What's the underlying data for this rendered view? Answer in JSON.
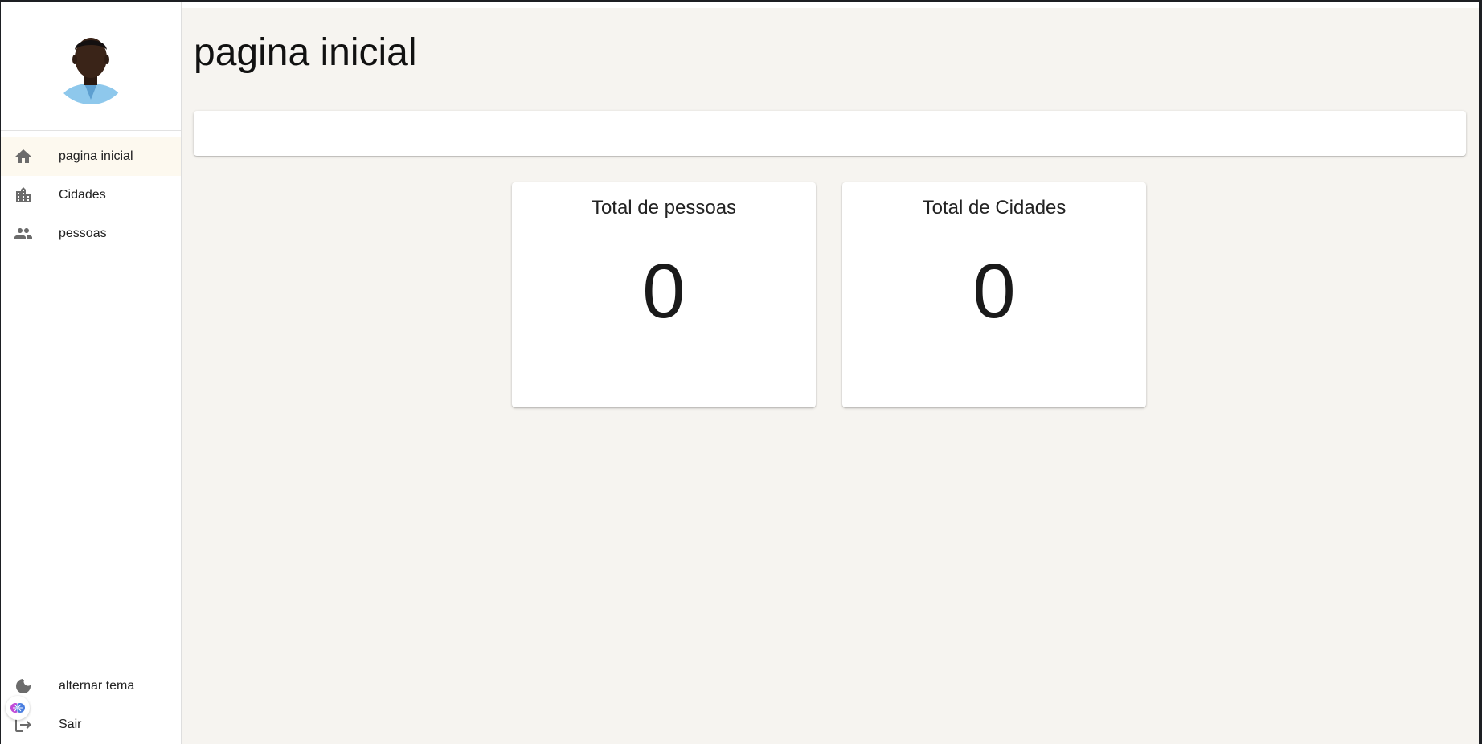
{
  "sidebar": {
    "items": [
      {
        "label": "pagina inicial",
        "icon": "home-icon",
        "active": true
      },
      {
        "label": "Cidades",
        "icon": "city-icon",
        "active": false
      },
      {
        "label": "pessoas",
        "icon": "people-icon",
        "active": false
      }
    ],
    "bottom_items": [
      {
        "label": "alternar tema",
        "icon": "moon-icon"
      },
      {
        "label": "Sair",
        "icon": "logout-icon"
      }
    ]
  },
  "main": {
    "title": "pagina inicial",
    "cards": [
      {
        "title": "Total de pessoas",
        "value": "0"
      },
      {
        "title": "Total de Cidades",
        "value": "0"
      }
    ]
  },
  "colors": {
    "background": "#f6f4f0",
    "sidebar": "#ffffff",
    "active_item": "#fdf9ef",
    "icon": "#6b6b6b"
  }
}
